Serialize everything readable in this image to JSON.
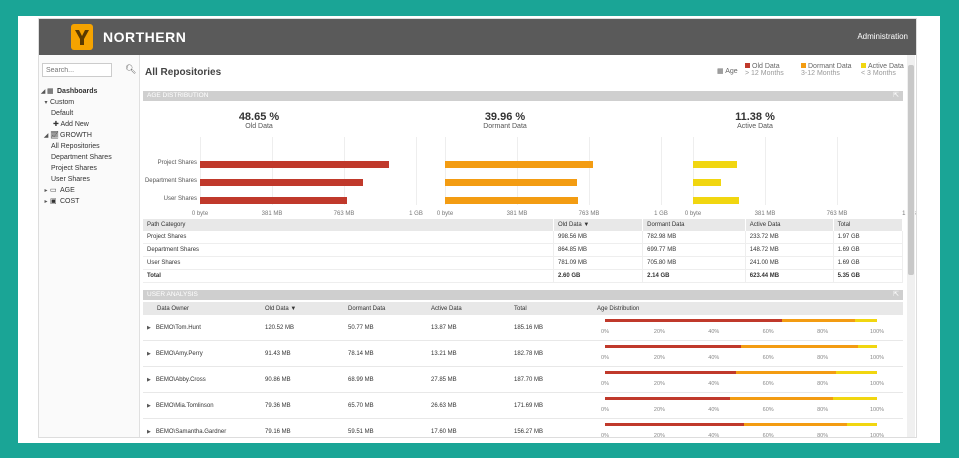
{
  "header": {
    "brand": "NORTHERN",
    "admin_link": "Administration"
  },
  "search": {
    "placeholder": "Search..."
  },
  "sidebar": {
    "items": [
      {
        "label": "Dashboards"
      },
      {
        "label": "Custom"
      },
      {
        "label": "Default"
      },
      {
        "label": "Add New"
      },
      {
        "label": "GROWTH"
      },
      {
        "label": "All Repositories"
      },
      {
        "label": "Department Shares"
      },
      {
        "label": "Project Shares"
      },
      {
        "label": "User Shares"
      },
      {
        "label": "AGE"
      },
      {
        "label": "COST"
      }
    ]
  },
  "page": {
    "title": "All Repositories"
  },
  "legend": {
    "title": "Age",
    "items": [
      {
        "name": "Old Data",
        "range": "> 12 Months",
        "color": "#c0392b"
      },
      {
        "name": "Dormant Data",
        "range": "3-12 Months",
        "color": "#f39c12"
      },
      {
        "name": "Active Data",
        "range": "< 3 Months",
        "color": "#f1d610"
      }
    ]
  },
  "age_distribution": {
    "header": "AGE DISTRIBUTION",
    "panels": [
      {
        "pct": "48.65 %",
        "label": "Old Data"
      },
      {
        "pct": "39.96 %",
        "label": "Dormant Data"
      },
      {
        "pct": "11.38 %",
        "label": "Active Data"
      }
    ],
    "categories": [
      "Project Shares",
      "Department Shares",
      "User Shares"
    ],
    "ticks": [
      "0 byte",
      "381 MB",
      "763 MB",
      "1 GB"
    ]
  },
  "chart_data": {
    "type": "bar",
    "categories": [
      "Project Shares",
      "Department Shares",
      "User Shares"
    ],
    "series": [
      {
        "name": "Old Data",
        "values": [
          998.56,
          864.85,
          781.09
        ]
      },
      {
        "name": "Dormant Data",
        "values": [
          782.98,
          699.77,
          705.8
        ]
      },
      {
        "name": "Active Data",
        "values": [
          233.72,
          148.72,
          241.0
        ]
      }
    ],
    "xlim": [
      0,
      1144
    ],
    "unit": "MB"
  },
  "path_table": {
    "headers": [
      "Path Category",
      "Old Data ▼",
      "Dormant Data",
      "Active Data",
      "Total"
    ],
    "rows": [
      [
        "Project Shares",
        "998.56 MB",
        "782.98 MB",
        "233.72 MB",
        "1.97 GB"
      ],
      [
        "Department Shares",
        "864.85 MB",
        "699.77 MB",
        "148.72 MB",
        "1.69 GB"
      ],
      [
        "User Shares",
        "781.09 MB",
        "705.80 MB",
        "241.00 MB",
        "1.69 GB"
      ]
    ],
    "total": [
      "Total",
      "2.60 GB",
      "2.14 GB",
      "623.44 MB",
      "5.35 GB"
    ]
  },
  "user_analysis": {
    "header": "USER ANALYSIS",
    "headers": [
      "Data Owner",
      "Old Data ▼",
      "Dormant Data",
      "Active Data",
      "Total",
      "Age Distribution"
    ],
    "axis": [
      "0%",
      "20%",
      "40%",
      "60%",
      "80%",
      "100%"
    ],
    "rows": [
      {
        "owner": "BEMO\\Tom.Hunt",
        "old": "120.52 MB",
        "dormant": "50.77 MB",
        "active": "13.87 MB",
        "total": "185.16 MB",
        "dist": [
          0.65,
          0.27,
          0.08
        ]
      },
      {
        "owner": "BEMO\\Amy.Perry",
        "old": "91.43 MB",
        "dormant": "78.14 MB",
        "active": "13.21 MB",
        "total": "182.78 MB",
        "dist": [
          0.5,
          0.43,
          0.07
        ]
      },
      {
        "owner": "BEMO\\Abby.Cross",
        "old": "90.86 MB",
        "dormant": "68.99 MB",
        "active": "27.85 MB",
        "total": "187.70 MB",
        "dist": [
          0.48,
          0.37,
          0.15
        ]
      },
      {
        "owner": "BEMO\\Mia.Tomlinson",
        "old": "79.36 MB",
        "dormant": "65.70 MB",
        "active": "26.63 MB",
        "total": "171.69 MB",
        "dist": [
          0.46,
          0.38,
          0.16
        ]
      },
      {
        "owner": "BEMO\\Samantha.Gardner",
        "old": "79.16 MB",
        "dormant": "59.51 MB",
        "active": "17.60 MB",
        "total": "156.27 MB",
        "dist": [
          0.51,
          0.38,
          0.11
        ]
      }
    ]
  }
}
